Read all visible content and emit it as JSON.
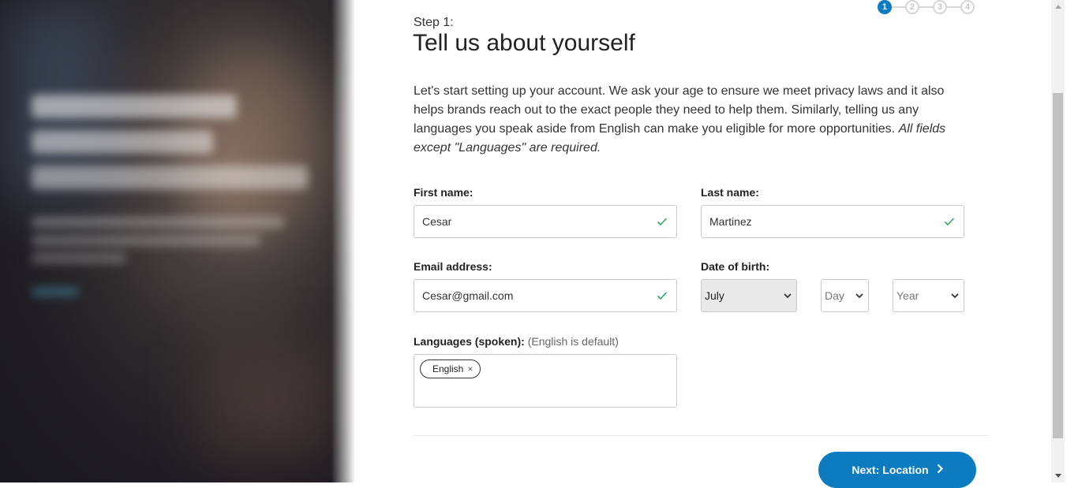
{
  "stepper": {
    "steps": [
      "1",
      "2",
      "3",
      "4"
    ],
    "active_index": 0,
    "active_color": "#0c7bc0"
  },
  "header": {
    "step_label": "Step 1:",
    "title": "Tell us about yourself"
  },
  "intro": {
    "text": "Let's start setting up your account. We ask your age to ensure we meet privacy laws and it also helps brands reach out to the exact people they need to help them. Similarly, telling us any languages you speak aside from English can make you eligible for more opportunities. ",
    "note": "All fields except \"Languages\" are required."
  },
  "form": {
    "first_name": {
      "label": "First name:",
      "value": "Cesar",
      "valid": true
    },
    "last_name": {
      "label": "Last name:",
      "value": "Martinez",
      "valid": true
    },
    "email": {
      "label": "Email address:",
      "value": "Cesar@gmail.com",
      "valid": true
    },
    "dob": {
      "label": "Date of birth:",
      "month": "July",
      "day": "Day",
      "year": "Year"
    },
    "languages": {
      "label": "Languages (spoken):",
      "hint": "(English is default)",
      "tags": [
        "English"
      ],
      "remove_glyph": "×"
    }
  },
  "actions": {
    "next_label": "Next: Location",
    "next_icon": "chevron-right-icon"
  },
  "colors": {
    "primary": "#0c7bc0",
    "valid": "#2eaa5c"
  }
}
